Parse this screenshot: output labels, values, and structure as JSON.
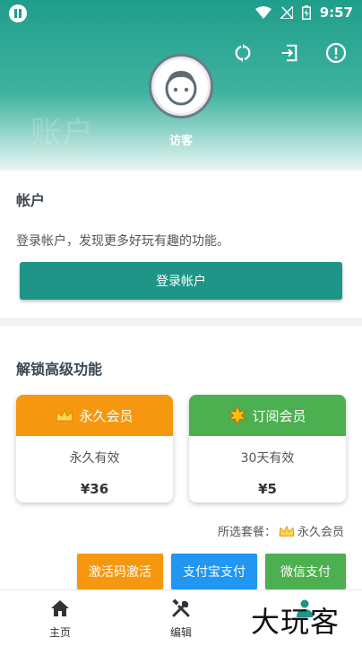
{
  "status_bar": {
    "time": "9:57"
  },
  "header": {
    "watermark": "账户",
    "visitor_name": "访客"
  },
  "account": {
    "title": "帐户",
    "description": "登录帐户，发现更多好玩有趣的功能。",
    "login_label": "登录帐户"
  },
  "unlock": {
    "title": "解锁高级功能",
    "plans": [
      {
        "name": "永久会员",
        "validity": "永久有效",
        "price": "¥36",
        "color": "#f5980f"
      },
      {
        "name": "订阅会员",
        "validity": "30天有效",
        "price": "¥5",
        "color": "#4caf50"
      }
    ],
    "selected_label": "所选套餐：",
    "selected_plan": "永久会员",
    "payments": [
      {
        "label": "激活码激活",
        "color": "#f5980f"
      },
      {
        "label": "支付宝支付",
        "color": "#2196f3"
      },
      {
        "label": "微信支付",
        "color": "#4caf50"
      }
    ]
  },
  "nav": {
    "home": "主页",
    "edit": "编辑"
  },
  "brand_watermark": "大玩客",
  "colors": {
    "primary": "#1e9586"
  }
}
